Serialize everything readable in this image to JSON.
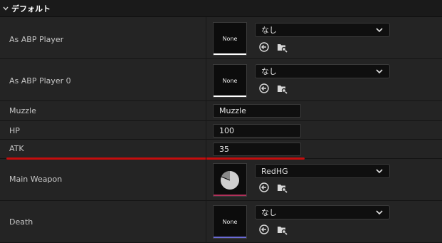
{
  "section": {
    "title": "デフォルト"
  },
  "rows": {
    "as_abp_player": {
      "label": "As ABP Player",
      "thumb_text": "None",
      "dropdown_value": "なし"
    },
    "as_abp_player_0": {
      "label": "As ABP Player 0",
      "thumb_text": "None",
      "dropdown_value": "なし"
    },
    "muzzle": {
      "label": "Muzzle",
      "value": "Muzzle"
    },
    "hp": {
      "label": "HP",
      "value": "100"
    },
    "atk": {
      "label": "ATK",
      "value": "35"
    },
    "main_weapon": {
      "label": "Main Weapon",
      "dropdown_value": "RedHG"
    },
    "death": {
      "label": "Death",
      "thumb_text": "None",
      "dropdown_value": "なし"
    }
  },
  "colors": {
    "background": "#242424",
    "header": "#1a1a1a",
    "field_bg": "#0f0f0f",
    "highlight_red": "#c40d0d",
    "thumb_bar_white": "#ffffff",
    "thumb_bar_weapon": "#b0305a",
    "thumb_bar_death": "#6a6ad6"
  },
  "icons": [
    "chevron-down-icon",
    "use-selected-asset-icon",
    "browse-asset-icon",
    "pie-thumbnail-icon"
  ]
}
